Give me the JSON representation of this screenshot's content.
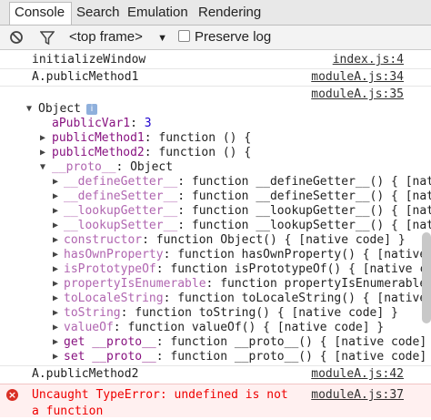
{
  "tabs": [
    "Console",
    "Search",
    "Emulation",
    "Rendering"
  ],
  "toolbar": {
    "frame_select": "<top frame>",
    "preserve_log_label": "Preserve log"
  },
  "console": {
    "line1": {
      "text": "initializeWindow",
      "src": "index.js:4"
    },
    "line2": {
      "text": "A.publicMethod1",
      "src": "moduleA.js:34"
    },
    "line3": {
      "src": "moduleA.js:35"
    },
    "object_label": "Object",
    "props": [
      {
        "name": "aPublicVar1",
        "value": "3"
      },
      {
        "name": "publicMethod1",
        "value": "function () {"
      },
      {
        "name": "publicMethod2",
        "value": "function () {"
      },
      {
        "name": "__proto__",
        "value": "Object"
      }
    ],
    "proto_props": [
      {
        "name": "__defineGetter__",
        "value": "function __defineGetter__() { [nat"
      },
      {
        "name": "__defineSetter__",
        "value": "function __defineSetter__() { [nat"
      },
      {
        "name": "__lookupGetter__",
        "value": "function __lookupGetter__() { [nat"
      },
      {
        "name": "__lookupSetter__",
        "value": "function __lookupSetter__() { [nat"
      },
      {
        "name": "constructor",
        "value": "function Object() { [native code] }"
      },
      {
        "name": "hasOwnProperty",
        "value": "function hasOwnProperty() { [native c"
      },
      {
        "name": "isPrototypeOf",
        "value": "function isPrototypeOf() { [native co"
      },
      {
        "name": "propertyIsEnumerable",
        "value": "function propertyIsEnumerable("
      },
      {
        "name": "toLocaleString",
        "value": "function toLocaleString() { [native c"
      },
      {
        "name": "toString",
        "value": "function toString() { [native code] }"
      },
      {
        "name": "valueOf",
        "value": "function valueOf() { [native code] }"
      },
      {
        "name": "get __proto__",
        "value": "function __proto__() { [native code]"
      },
      {
        "name": "set __proto__",
        "value": "function __proto__() { [native code]"
      }
    ],
    "line_after": {
      "text": "A.publicMethod2",
      "src": "moduleA.js:42"
    },
    "error": {
      "text": "Uncaught TypeError: undefined is not a function",
      "src": "moduleA.js:37"
    }
  },
  "colors": {
    "property": "#881280",
    "error": "#e00000",
    "number": "#1c00cf"
  }
}
